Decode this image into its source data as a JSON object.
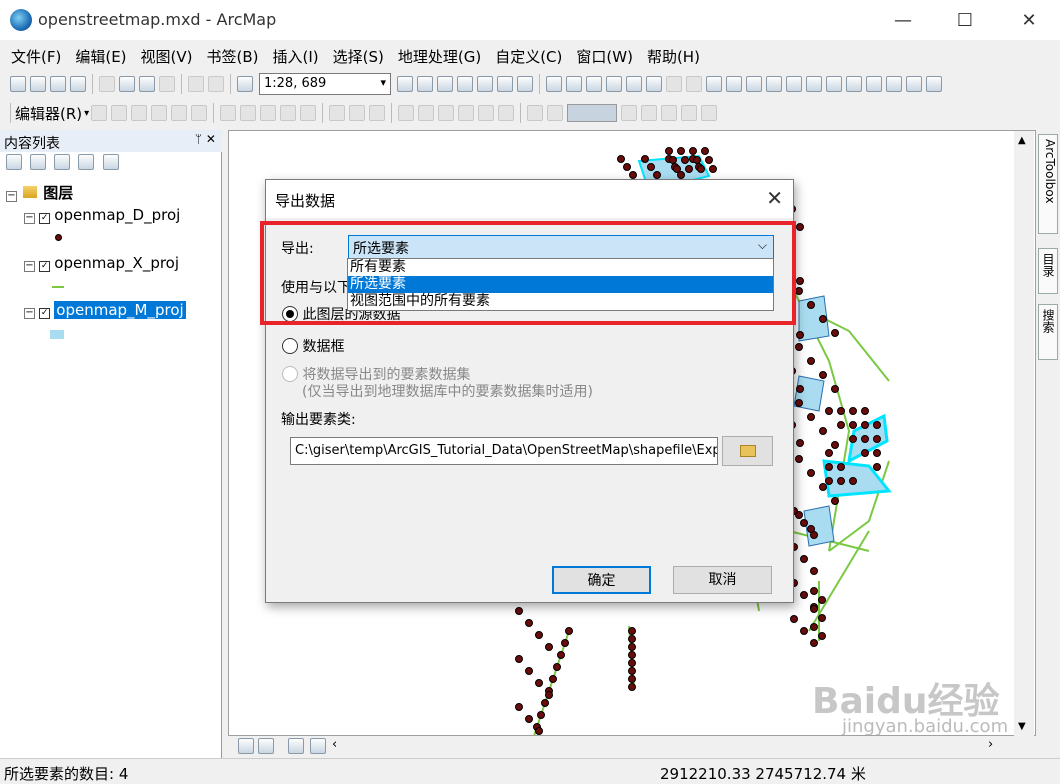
{
  "window": {
    "title": "openstreetmap.mxd - ArcMap",
    "min": "—",
    "max": "☐",
    "close": "✕"
  },
  "menu": [
    "文件(F)",
    "编辑(E)",
    "视图(V)",
    "书签(B)",
    "插入(I)",
    "选择(S)",
    "地理处理(G)",
    "自定义(C)",
    "窗口(W)",
    "帮助(H)"
  ],
  "toolbar": {
    "scale": "1:28, 689",
    "editor_label": "编辑器(R)",
    "scale_arrow": "▾"
  },
  "toc": {
    "title": "内容列表",
    "pin": "ᛘ ✕",
    "group": "图层",
    "layers": [
      "openmap_D_proj",
      "openmap_X_proj",
      "openmap_M_proj"
    ],
    "selected_layer": "openmap_M_proj"
  },
  "right_tabs": [
    "ArcToolbox",
    "目录",
    "搜索"
  ],
  "dialog": {
    "title": "导出数据",
    "close": "✕",
    "export_label": "导出:",
    "export_value": "所选要素",
    "dropdown_options": [
      "所有要素",
      "所选要素",
      "视图范围中的所有要素"
    ],
    "selected_option_index": 1,
    "use_label": "使用与以下",
    "radio1": "此图层的源数据",
    "radio2": "数据框",
    "radio3": "将数据导出到的要素数据集",
    "radio3_note": "(仅当导出到地理数据库中的要素数据集时适用)",
    "output_label": "输出要素类:",
    "output_path": "C:\\giser\\temp\\ArcGIS_Tutorial_Data\\OpenStreetMap\\shapefile\\Exp",
    "ok": "确定",
    "cancel": "取消"
  },
  "status": {
    "left": "所选要素的数目: 4",
    "coords": "2912210.33  2745712.74 米"
  },
  "watermark": {
    "brand": "Baidu经验",
    "url": "jingyan.baidu.com"
  },
  "colors": {
    "highlight": "#0078d7",
    "red_box": "#e8242a",
    "poly_fill": "#a9dcf0",
    "poly_stroke": "#00e5ff",
    "point": "#6b0c0c",
    "line": "#7ac943"
  }
}
